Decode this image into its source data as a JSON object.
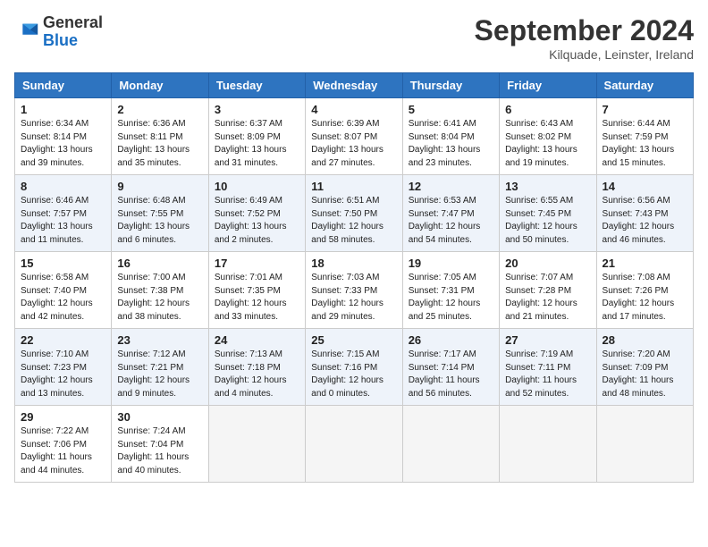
{
  "header": {
    "logo_general": "General",
    "logo_blue": "Blue",
    "month_title": "September 2024",
    "location": "Kilquade, Leinster, Ireland"
  },
  "days_of_week": [
    "Sunday",
    "Monday",
    "Tuesday",
    "Wednesday",
    "Thursday",
    "Friday",
    "Saturday"
  ],
  "weeks": [
    [
      {
        "day": "1",
        "sunrise": "6:34 AM",
        "sunset": "8:14 PM",
        "daylight": "13 hours and 39 minutes."
      },
      {
        "day": "2",
        "sunrise": "6:36 AM",
        "sunset": "8:11 PM",
        "daylight": "13 hours and 35 minutes."
      },
      {
        "day": "3",
        "sunrise": "6:37 AM",
        "sunset": "8:09 PM",
        "daylight": "13 hours and 31 minutes."
      },
      {
        "day": "4",
        "sunrise": "6:39 AM",
        "sunset": "8:07 PM",
        "daylight": "13 hours and 27 minutes."
      },
      {
        "day": "5",
        "sunrise": "6:41 AM",
        "sunset": "8:04 PM",
        "daylight": "13 hours and 23 minutes."
      },
      {
        "day": "6",
        "sunrise": "6:43 AM",
        "sunset": "8:02 PM",
        "daylight": "13 hours and 19 minutes."
      },
      {
        "day": "7",
        "sunrise": "6:44 AM",
        "sunset": "7:59 PM",
        "daylight": "13 hours and 15 minutes."
      }
    ],
    [
      {
        "day": "8",
        "sunrise": "6:46 AM",
        "sunset": "7:57 PM",
        "daylight": "13 hours and 11 minutes."
      },
      {
        "day": "9",
        "sunrise": "6:48 AM",
        "sunset": "7:55 PM",
        "daylight": "13 hours and 6 minutes."
      },
      {
        "day": "10",
        "sunrise": "6:49 AM",
        "sunset": "7:52 PM",
        "daylight": "13 hours and 2 minutes."
      },
      {
        "day": "11",
        "sunrise": "6:51 AM",
        "sunset": "7:50 PM",
        "daylight": "12 hours and 58 minutes."
      },
      {
        "day": "12",
        "sunrise": "6:53 AM",
        "sunset": "7:47 PM",
        "daylight": "12 hours and 54 minutes."
      },
      {
        "day": "13",
        "sunrise": "6:55 AM",
        "sunset": "7:45 PM",
        "daylight": "12 hours and 50 minutes."
      },
      {
        "day": "14",
        "sunrise": "6:56 AM",
        "sunset": "7:43 PM",
        "daylight": "12 hours and 46 minutes."
      }
    ],
    [
      {
        "day": "15",
        "sunrise": "6:58 AM",
        "sunset": "7:40 PM",
        "daylight": "12 hours and 42 minutes."
      },
      {
        "day": "16",
        "sunrise": "7:00 AM",
        "sunset": "7:38 PM",
        "daylight": "12 hours and 38 minutes."
      },
      {
        "day": "17",
        "sunrise": "7:01 AM",
        "sunset": "7:35 PM",
        "daylight": "12 hours and 33 minutes."
      },
      {
        "day": "18",
        "sunrise": "7:03 AM",
        "sunset": "7:33 PM",
        "daylight": "12 hours and 29 minutes."
      },
      {
        "day": "19",
        "sunrise": "7:05 AM",
        "sunset": "7:31 PM",
        "daylight": "12 hours and 25 minutes."
      },
      {
        "day": "20",
        "sunrise": "7:07 AM",
        "sunset": "7:28 PM",
        "daylight": "12 hours and 21 minutes."
      },
      {
        "day": "21",
        "sunrise": "7:08 AM",
        "sunset": "7:26 PM",
        "daylight": "12 hours and 17 minutes."
      }
    ],
    [
      {
        "day": "22",
        "sunrise": "7:10 AM",
        "sunset": "7:23 PM",
        "daylight": "12 hours and 13 minutes."
      },
      {
        "day": "23",
        "sunrise": "7:12 AM",
        "sunset": "7:21 PM",
        "daylight": "12 hours and 9 minutes."
      },
      {
        "day": "24",
        "sunrise": "7:13 AM",
        "sunset": "7:18 PM",
        "daylight": "12 hours and 4 minutes."
      },
      {
        "day": "25",
        "sunrise": "7:15 AM",
        "sunset": "7:16 PM",
        "daylight": "12 hours and 0 minutes."
      },
      {
        "day": "26",
        "sunrise": "7:17 AM",
        "sunset": "7:14 PM",
        "daylight": "11 hours and 56 minutes."
      },
      {
        "day": "27",
        "sunrise": "7:19 AM",
        "sunset": "7:11 PM",
        "daylight": "11 hours and 52 minutes."
      },
      {
        "day": "28",
        "sunrise": "7:20 AM",
        "sunset": "7:09 PM",
        "daylight": "11 hours and 48 minutes."
      }
    ],
    [
      {
        "day": "29",
        "sunrise": "7:22 AM",
        "sunset": "7:06 PM",
        "daylight": "11 hours and 44 minutes."
      },
      {
        "day": "30",
        "sunrise": "7:24 AM",
        "sunset": "7:04 PM",
        "daylight": "11 hours and 40 minutes."
      },
      null,
      null,
      null,
      null,
      null
    ]
  ]
}
